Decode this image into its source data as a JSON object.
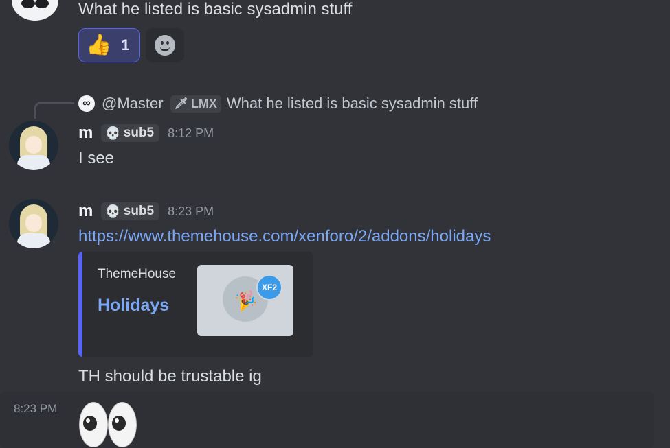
{
  "messages": {
    "first": {
      "text": "What he listed is basic sysadmin stuff"
    },
    "reaction": {
      "emoji": "👍",
      "count": "1"
    },
    "reply": {
      "avatar_glyph": "∞",
      "username": "@Master",
      "role_icon": "🗡",
      "role": "LMX",
      "text": "What he listed is basic sysadmin stuff"
    },
    "second": {
      "username": "m",
      "badge_icon": "💀",
      "badge": "sub5",
      "time": "8:12 PM",
      "text": "I see"
    },
    "third": {
      "username": "m",
      "badge_icon": "💀",
      "badge": "sub5",
      "time": "8:23 PM",
      "link": "https://www.themehouse.com/xenforo/2/addons/holidays",
      "embed": {
        "provider": "ThemeHouse",
        "title": "Holidays",
        "thumb_badge": "XF2",
        "thumb_icon": "🎉"
      },
      "text": "TH should be trustable ig"
    },
    "fourth": {
      "time": "8:23 PM",
      "emoji_name": "eyes"
    }
  },
  "colors": {
    "background": "#313338",
    "accent": "#5865f2",
    "link": "#7ba7f5",
    "badge_green": "#57f287"
  }
}
